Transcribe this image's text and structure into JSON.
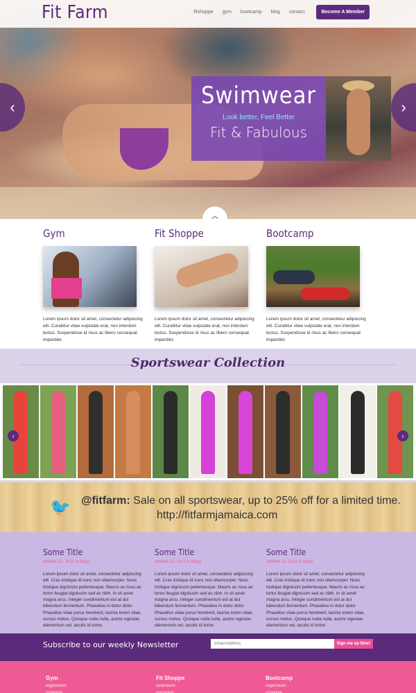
{
  "header": {
    "logo": "Fit Farm",
    "nav": [
      "fitshoppe",
      "gym",
      "bootcamp",
      "blog",
      "contact"
    ],
    "member_button": "Become A Member"
  },
  "hero": {
    "title": "Swimwear",
    "tagline": "Look better, Feel Better",
    "subtitle": "Fit & Fabulous",
    "prev": "‹",
    "next": "›",
    "up": "︿"
  },
  "features": [
    {
      "title": "Gym",
      "text": "Lorem ipsum dolor sit amet, consectetur adipiscing elit. Curabitur vitae vulputate erat, non interdum lectus. Suspendisse id risus ac libero consequat imperdiet."
    },
    {
      "title": "Fit Shoppe",
      "text": "Lorem ipsum dolor sit amet, consectetur adipiscing elit. Curabitur vitae vulputate erat, non interdum lectus. Suspendisse id risus ac libero consequat imperdiet."
    },
    {
      "title": "Bootcamp",
      "text": "Lorem ipsum dolor sit amet, consectetur adipiscing elit. Curabitur vitae vulputate erat, non interdum lectus. Suspendisse id risus ac libero consequat imperdiet."
    }
  ],
  "collection": {
    "title": "Sportswear Collection",
    "prev": "‹",
    "next": "›"
  },
  "tweet": {
    "handle": "@fitfarm:",
    "message": " Sale on all sportswear, up to 25% off for a limited time.",
    "url": "http://fitfarmjamaica.com"
  },
  "posts": [
    {
      "title": "Some Title",
      "date": "october 12, 2013",
      "in": " in ",
      "category": "blogs",
      "text": "Lorem ipsum dolor sit amet, consectetur adipiscing elit. Cras tristique id nunc non ullamcorper. Nunc tristique dignissim pellentesque. Mauris ac risus ac tortor feugiat dignissim sed ac nibh. In sit amet magna arcu. Integer condimentum est at dui bibendum fermentum. Phasellus in dolor dolor. Phasellus vitae purus hendrerit, lacinia lorem vitae, cursus metus. Quisque nulla nulla, auctor egestas elementum vel, iaculis id tortor."
    },
    {
      "title": "Some Title",
      "date": "october 12, 2013",
      "in": " in ",
      "category": "blogs",
      "text": "Lorem ipsum dolor sit amet, consectetur adipiscing elit. Cras tristique id nunc non ullamcorper. Nunc tristique dignissim pellentesque. Mauris ac risus ac tortor feugiat dignissim sed ac nibh. In sit amet magna arcu. Integer condimentum est at dui bibendum fermentum. Phasellus in dolor dolor. Phasellus vitae purus hendrerit, lacinia lorem vitae, cursus metus. Quisque nulla nulla, auctor egestas elementum vel, iaculis id tortor."
    },
    {
      "title": "Some Title",
      "date": "october 12, 2013",
      "in": " in ",
      "category": "blogs",
      "text": "Lorem ipsum dolor sit amet, consectetur adipiscing elit. Cras tristique id nunc non ullamcorper. Nunc tristique dignissim pellentesque. Mauris ac risus ac tortor feugiat dignissim sed ac nibh. In sit amet magna arcu. Integer condimentum est at dui bibendum fermentum. Phasellus in dolor dolor. Phasellus vitae purus hendrerit, lacinia lorem vitae, cursus metus. Quisque nulla nulla, auctor egestas elementum vel, iaculis id tortor."
    }
  ],
  "newsletter": {
    "label": "Subscribe to our weekly Newsletter",
    "placeholder": "Email Address",
    "button": "Sign me up Now!"
  },
  "footer": [
    {
      "title": "Gym",
      "links": [
        "registration",
        "schedule"
      ]
    },
    {
      "title": "Fit Shoppe",
      "links": [
        "collections",
        "upcoming"
      ]
    },
    {
      "title": "Bootcamp",
      "links": [
        "registration",
        "schedule"
      ]
    }
  ]
}
